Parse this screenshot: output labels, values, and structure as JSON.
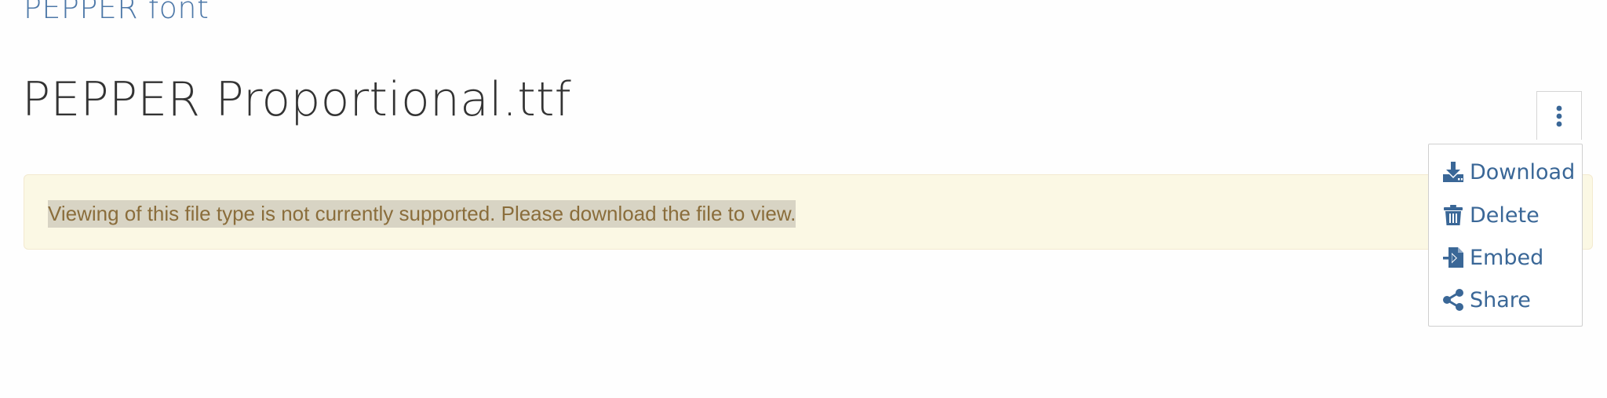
{
  "breadcrumb": {
    "parent_label": "PEPPER font"
  },
  "header": {
    "title": "PEPPER Proportional.ttf"
  },
  "alert": {
    "message": "Viewing of this file type is not currently supported. Please download the file to view."
  },
  "actions_menu": {
    "toggle_icon": "vertical-ellipsis-icon",
    "items": [
      {
        "label": "Download",
        "icon": "download-icon"
      },
      {
        "label": "Delete",
        "icon": "trash-icon"
      },
      {
        "label": "Embed",
        "icon": "embed-icon"
      },
      {
        "label": "Share",
        "icon": "share-icon"
      }
    ]
  },
  "colors": {
    "link": "#3a6797",
    "alert_background": "#fbf8e4",
    "alert_text": "#8a6d3b",
    "title_text": "#333333"
  }
}
